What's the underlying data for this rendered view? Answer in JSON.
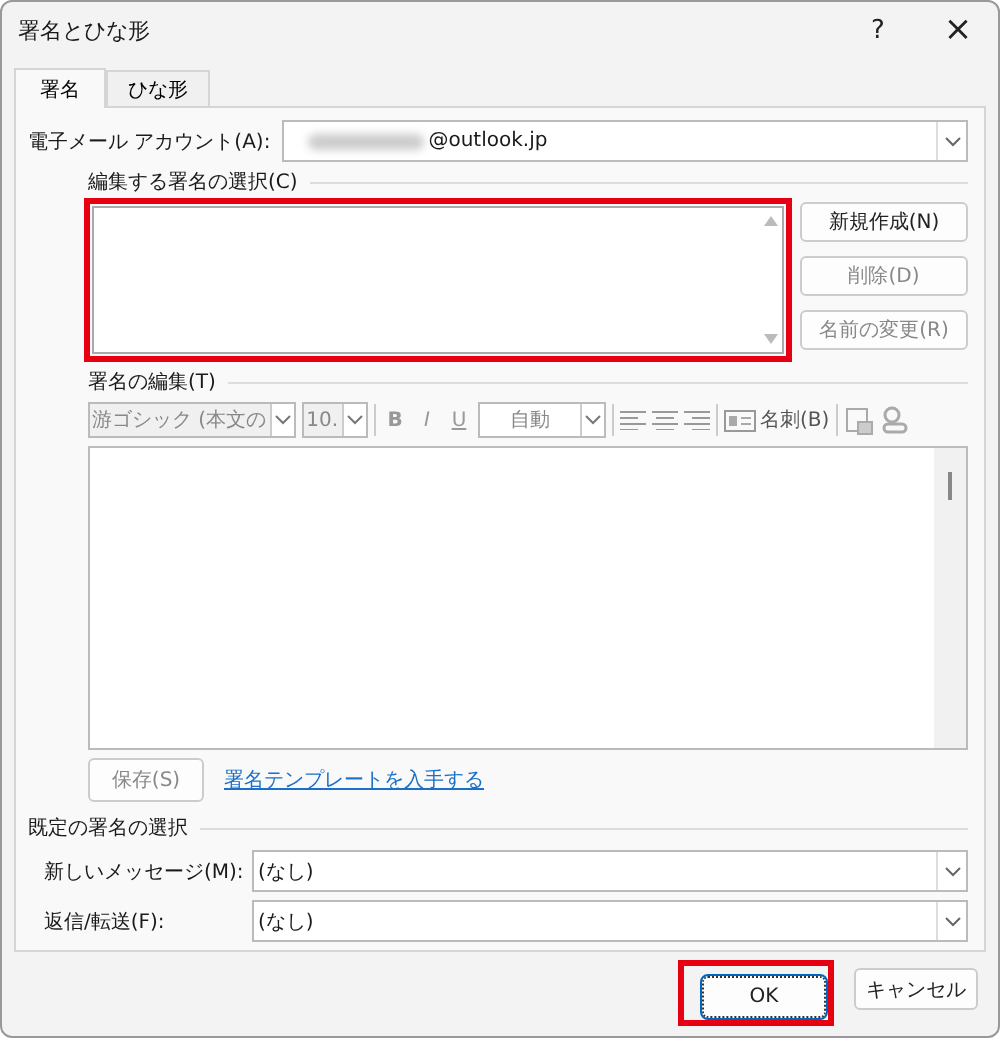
{
  "window": {
    "title": "署名とひな形",
    "help": "?",
    "close": "×"
  },
  "tabs": [
    {
      "label": "署名",
      "selected": true
    },
    {
      "label": "ひな形",
      "selected": false
    }
  ],
  "account": {
    "label": "電子メール アカウント(A):",
    "value": "@outlook.jp",
    "redacted": true
  },
  "select_section": {
    "title": "編集する署名の選択(C)",
    "highlighted": true,
    "buttons": [
      {
        "label": "新規作成(N)",
        "disabled": false
      },
      {
        "label": "削除(D)",
        "disabled": true
      },
      {
        "label": "名前の変更(R)",
        "disabled": true
      }
    ]
  },
  "edit_section": {
    "title": "署名の編集(T)",
    "toolbar": {
      "font": "游ゴシック (本文の",
      "size": "10.",
      "bold": "B",
      "italic": "I",
      "underline": "U",
      "font_color": "自動",
      "card": "名刺(B)",
      "disabled": true
    },
    "save": {
      "label": "保存(S)",
      "disabled": true
    },
    "link": "署名テンプレートを入手する"
  },
  "default_section": {
    "title": "既定の署名の選択",
    "fields": [
      {
        "label": "新しいメッセージ(M):",
        "value": "(なし)"
      },
      {
        "label": "返信/転送(F):",
        "value": "(なし)"
      }
    ]
  },
  "buttons": [
    {
      "label": "OK",
      "highlighted": true
    },
    {
      "label": "キャンセル",
      "highlighted": false
    }
  ]
}
